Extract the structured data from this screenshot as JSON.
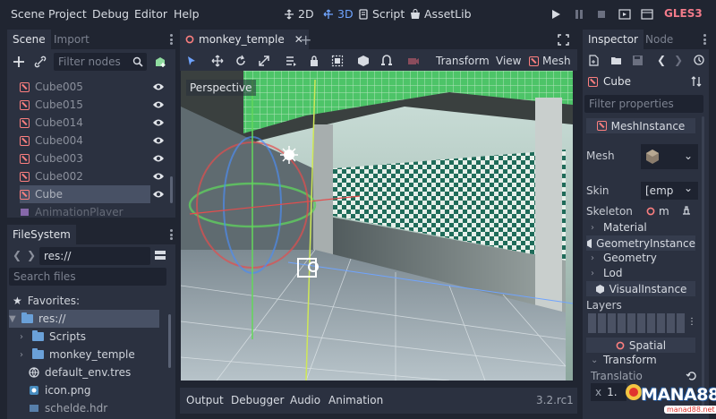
{
  "menu": [
    "Scene",
    "Project",
    "Debug",
    "Editor",
    "Help"
  ],
  "workspaces": {
    "two_d": "2D",
    "three_d": "3D",
    "script": "Script",
    "assetlib": "AssetLib"
  },
  "renderer": "GLES3",
  "scene_panel": {
    "tab_scene": "Scene",
    "tab_import": "Import",
    "filter_placeholder": "Filter nodes",
    "nodes": [
      "Cube005",
      "Cube015",
      "Cube014",
      "Cube004",
      "Cube003",
      "Cube002",
      "Cube",
      "AnimationPlayer"
    ]
  },
  "filesystem": {
    "tab": "FileSystem",
    "path": "res://",
    "search_placeholder": "Search files",
    "favorites": "Favorites:",
    "items": [
      "res://",
      "Scripts",
      "monkey_temple",
      "default_env.tres",
      "icon.png",
      "schelde.hdr"
    ]
  },
  "editor": {
    "tab_name": "monkey_temple",
    "toolbar": {
      "transform": "Transform",
      "view": "View",
      "mesh": "Mesh"
    },
    "viewport_label": "Perspective"
  },
  "bottom_panel": {
    "tabs": [
      "Output",
      "Debugger",
      "Audio",
      "Animation"
    ],
    "version": "3.2.rc1"
  },
  "inspector": {
    "tab_inspector": "Inspector",
    "tab_node": "Node",
    "node_name": "Cube",
    "filter_placeholder": "Filter properties",
    "mesh_instance": "MeshInstance",
    "mesh_label": "Mesh",
    "skin_label": "Skin",
    "skin_value": "[emp",
    "skeleton_label": "Skeleton",
    "skeleton_value": "m",
    "material": "Material",
    "geometry_instance": "GeometryInstance",
    "geometry": "Geometry",
    "lod": "Lod",
    "visual_instance": "VisualInstance",
    "layers": "Layers",
    "spatial": "Spatial",
    "transform": "Transform",
    "translation": "Translatio",
    "x_label": "x",
    "x_value": "1."
  },
  "watermark": {
    "main": "MANA88",
    "sub": "manad88.net"
  },
  "colors": {
    "accent": "#6fa4ff",
    "mesh_icon": "#fc7f7f",
    "renderer": "#f27b8a",
    "panel": "#2b3140",
    "bg": "#202531"
  }
}
